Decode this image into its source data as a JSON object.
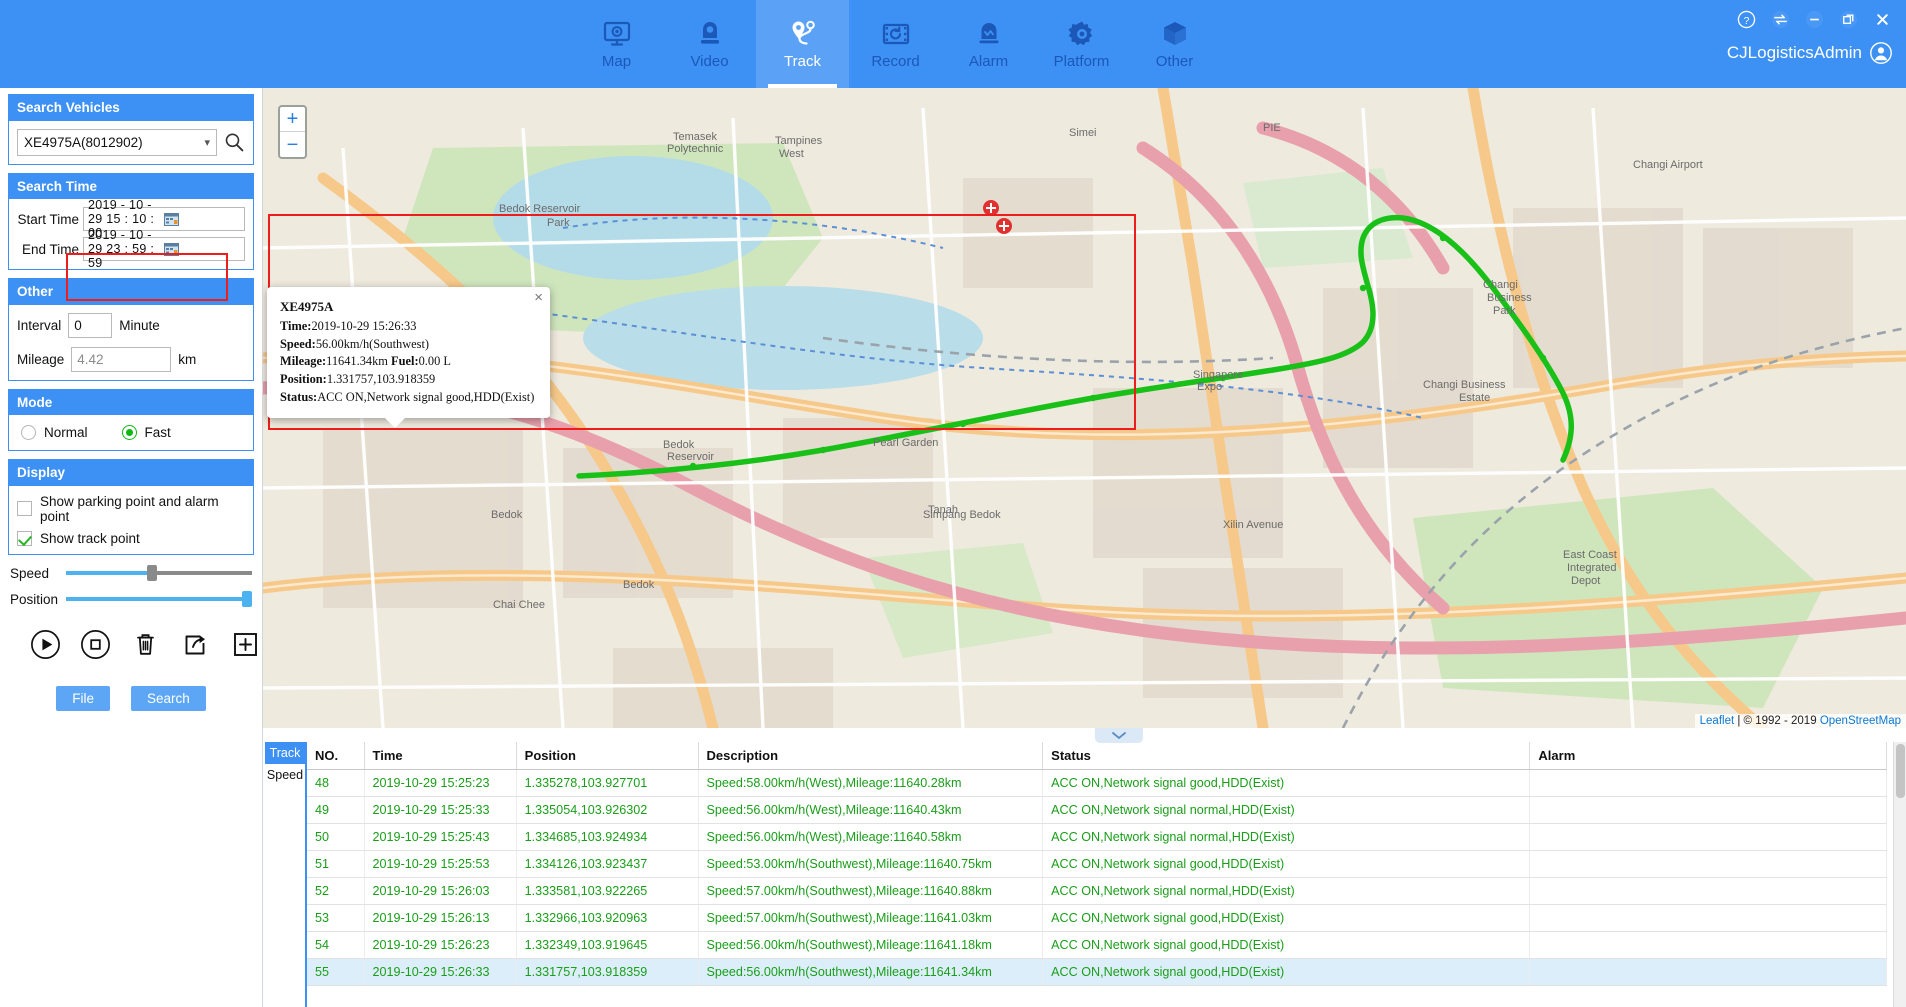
{
  "header": {
    "nav": [
      {
        "label": "Map",
        "icon": "map-monitor-icon",
        "active": false
      },
      {
        "label": "Video",
        "icon": "video-camera-icon",
        "active": false
      },
      {
        "label": "Track",
        "icon": "track-route-icon",
        "active": true
      },
      {
        "label": "Record",
        "icon": "record-film-icon",
        "active": false
      },
      {
        "label": "Alarm",
        "icon": "alarm-bell-icon",
        "active": false
      },
      {
        "label": "Platform",
        "icon": "gear-icon",
        "active": false
      },
      {
        "label": "Other",
        "icon": "cube-icon",
        "active": false
      }
    ],
    "window_buttons": [
      "help-icon",
      "switch-icon",
      "minimize-icon",
      "maximize-icon",
      "close-icon"
    ],
    "username": "CJLogisticsAdmin"
  },
  "sidebar": {
    "search_vehicles": {
      "title": "Search Vehicles",
      "selected_vehicle": "XE4975A(8012902)",
      "options": [
        "XE4975A(8012902)"
      ]
    },
    "search_time": {
      "title": "Search Time",
      "start_label": "Start Time",
      "start_value": "2019 - 10 - 29  15 : 10 : 00",
      "end_label": "End Time",
      "end_value": "2019 - 10 - 29  23 : 59 : 59"
    },
    "other": {
      "title": "Other",
      "interval_label": "Interval",
      "interval_value": "0",
      "interval_unit": "Minute",
      "mileage_label": "Mileage",
      "mileage_value": "4.42",
      "mileage_unit": "km"
    },
    "mode": {
      "title": "Mode",
      "normal_label": "Normal",
      "fast_label": "Fast",
      "selected": "Fast"
    },
    "display": {
      "title": "Display",
      "parking_label": "Show parking point and alarm point",
      "parking_checked": false,
      "track_label": "Show track point",
      "track_checked": true
    },
    "speed_label": "Speed",
    "speed_percent": 46,
    "position_label": "Position",
    "position_percent": 100,
    "controls": [
      "play-button",
      "stop-button",
      "delete-button",
      "export-button",
      "add-button"
    ],
    "file_button": "File",
    "search_button": "Search"
  },
  "map": {
    "zoom_in": "+",
    "zoom_out": "−",
    "marker_label": "XE4975A",
    "popup": {
      "title": "XE4975A",
      "time_label": "Time:",
      "time_value": "2019-10-29 15:26:33 ",
      "speed_label": "Speed:",
      "speed_value": "56.00km/h(Southwest)",
      "mileage_label": "Mileage:",
      "mileage_value": "11641.34km ",
      "fuel_label": "Fuel:",
      "fuel_value": "0.00 L",
      "position_label": "Position:",
      "position_value": "1.331757,103.918359",
      "status_label": "Status:",
      "status_value": "ACC ON,Network signal good,HDD(Exist)",
      "close": "×"
    },
    "attribution_leaflet": "Leaflet",
    "attribution_sep": " | © 1992 - 2019 ",
    "attribution_osm": "OpenStreetMap"
  },
  "bottom": {
    "tabs": [
      {
        "label": "Track",
        "active": true
      },
      {
        "label": "Speed",
        "active": false
      }
    ],
    "columns": [
      "NO.",
      "Time",
      "Position",
      "Description",
      "Status",
      "Alarm"
    ],
    "rows": [
      {
        "no": "48",
        "time": "2019-10-29 15:25:23",
        "position": "1.335278,103.927701",
        "description": "Speed:58.00km/h(West),Mileage:11640.28km",
        "status": "ACC ON,Network signal good,HDD(Exist)",
        "alarm": "",
        "selected": false
      },
      {
        "no": "49",
        "time": "2019-10-29 15:25:33",
        "position": "1.335054,103.926302",
        "description": "Speed:56.00km/h(West),Mileage:11640.43km",
        "status": "ACC ON,Network signal normal,HDD(Exist)",
        "alarm": "",
        "selected": false
      },
      {
        "no": "50",
        "time": "2019-10-29 15:25:43",
        "position": "1.334685,103.924934",
        "description": "Speed:56.00km/h(West),Mileage:11640.58km",
        "status": "ACC ON,Network signal normal,HDD(Exist)",
        "alarm": "",
        "selected": false
      },
      {
        "no": "51",
        "time": "2019-10-29 15:25:53",
        "position": "1.334126,103.923437",
        "description": "Speed:53.00km/h(Southwest),Mileage:11640.75km",
        "status": "ACC ON,Network signal good,HDD(Exist)",
        "alarm": "",
        "selected": false
      },
      {
        "no": "52",
        "time": "2019-10-29 15:26:03",
        "position": "1.333581,103.922265",
        "description": "Speed:57.00km/h(Southwest),Mileage:11640.88km",
        "status": "ACC ON,Network signal normal,HDD(Exist)",
        "alarm": "",
        "selected": false
      },
      {
        "no": "53",
        "time": "2019-10-29 15:26:13",
        "position": "1.332966,103.920963",
        "description": "Speed:57.00km/h(Southwest),Mileage:11641.03km",
        "status": "ACC ON,Network signal good,HDD(Exist)",
        "alarm": "",
        "selected": false
      },
      {
        "no": "54",
        "time": "2019-10-29 15:26:23",
        "position": "1.332349,103.919645",
        "description": "Speed:56.00km/h(Southwest),Mileage:11641.18km",
        "status": "ACC ON,Network signal good,HDD(Exist)",
        "alarm": "",
        "selected": false
      },
      {
        "no": "55",
        "time": "2019-10-29 15:26:33",
        "position": "1.331757,103.918359",
        "description": "Speed:56.00km/h(Southwest),Mileage:11641.34km",
        "status": "ACC ON,Network signal good,HDD(Exist)",
        "alarm": "",
        "selected": true
      }
    ]
  },
  "colors": {
    "brand_blue": "#3d90f4",
    "active_nav": "#5ba2f7",
    "green_text": "#1a9e1a",
    "highlight_red": "#ee1d1d",
    "selected_row": "#ddeefb",
    "track_green": "#18c018"
  }
}
